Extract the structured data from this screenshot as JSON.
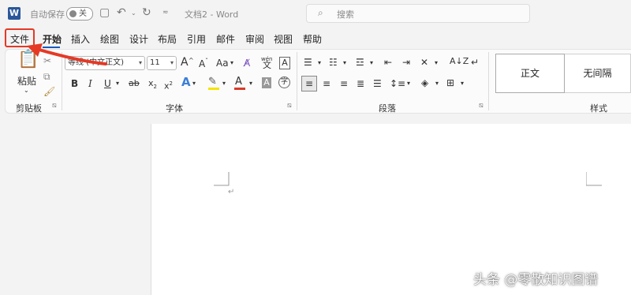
{
  "titlebar": {
    "app_logo": "W",
    "autosave_label": "自动保存",
    "autosave_state": "关",
    "doc_title": "文档2  -  Word",
    "search_placeholder": "搜索"
  },
  "tabs": [
    {
      "label": "文件"
    },
    {
      "label": "开始"
    },
    {
      "label": "插入"
    },
    {
      "label": "绘图"
    },
    {
      "label": "设计"
    },
    {
      "label": "布局"
    },
    {
      "label": "引用"
    },
    {
      "label": "邮件"
    },
    {
      "label": "审阅"
    },
    {
      "label": "视图"
    },
    {
      "label": "帮助"
    }
  ],
  "active_tab": "开始",
  "ribbon": {
    "clipboard": {
      "paste_label": "粘贴",
      "group_label": "剪贴板"
    },
    "font": {
      "font_name": "等线 (中文正文)",
      "font_size": "11",
      "group_label": "字体",
      "grow_label": "A",
      "shrink_label": "A",
      "case_label": "Aa",
      "phonetic_label": "wén",
      "bold": "B",
      "italic": "I",
      "underline": "U",
      "strike": "ab",
      "subscript": "x",
      "superscript": "x",
      "highlight_color": "#f5e400",
      "font_color": "#d83b2b"
    },
    "paragraph": {
      "group_label": "段落"
    },
    "styles": {
      "group_label": "样式",
      "items": [
        {
          "label": "正文"
        },
        {
          "label": "无间隔"
        }
      ]
    }
  },
  "document": {
    "paragraph_mark": "↵"
  },
  "watermark": "头条 @零散知识图谱",
  "colors": {
    "accent": "#185abd",
    "highlight_border": "#e53925",
    "arrow": "#e53925"
  }
}
